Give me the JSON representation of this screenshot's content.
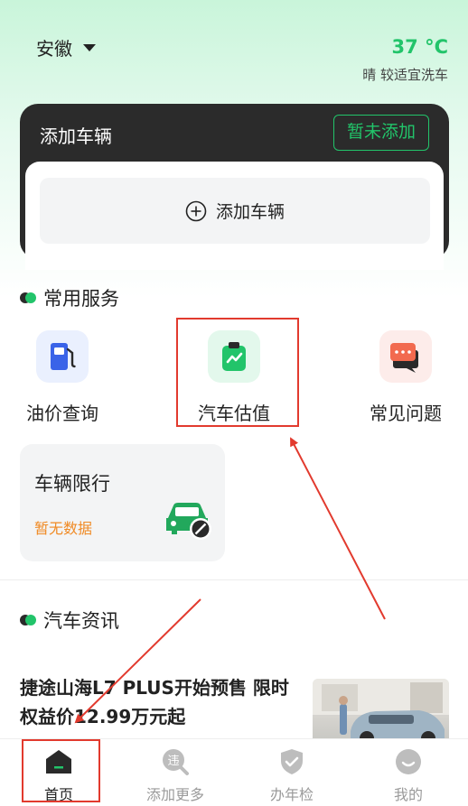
{
  "header": {
    "location": "安徽",
    "temperature": "37 °C",
    "weather": "晴 较适宜洗车"
  },
  "vehicle_card": {
    "title": "添加车辆",
    "not_now_button": "暂未添加",
    "add_button": "添加车辆"
  },
  "services": {
    "section_title": "常用服务",
    "items": [
      {
        "label": "油价查询",
        "icon": "fuel-pump-icon"
      },
      {
        "label": "汽车估值",
        "icon": "valuation-clipboard-icon"
      },
      {
        "label": "常见问题",
        "icon": "chat-bubbles-icon"
      }
    ]
  },
  "restriction": {
    "title": "车辆限行",
    "status": "暂无数据"
  },
  "news": {
    "section_title": "汽车资讯",
    "headline": "捷途山海L7 PLUS开始预售 限时权益价12.99万元起"
  },
  "bottom_nav": {
    "items": [
      {
        "label": "首页",
        "icon": "home-icon",
        "active": true
      },
      {
        "label": "添加更多",
        "icon": "violation-search-icon",
        "active": false
      },
      {
        "label": "办年检",
        "icon": "shield-check-icon",
        "active": false
      },
      {
        "label": "我的",
        "icon": "profile-smile-icon",
        "active": false
      }
    ]
  },
  "colors": {
    "accent": "#22c46a",
    "card_dark": "#2b2b2b",
    "warning": "#f08a24",
    "annotation": "#e23a2e"
  }
}
